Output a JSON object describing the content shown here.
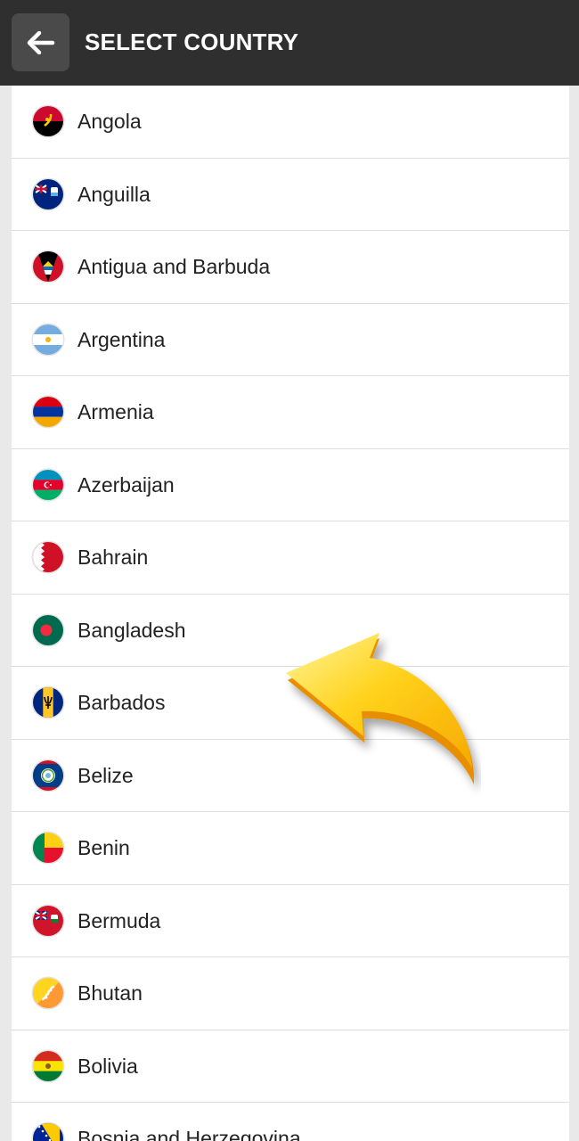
{
  "header": {
    "title": "SELECT COUNTRY",
    "back_icon": "arrow-left-icon"
  },
  "countries": [
    {
      "name": "Angola",
      "flag": "angola-flag-icon"
    },
    {
      "name": "Anguilla",
      "flag": "anguilla-flag-icon"
    },
    {
      "name": "Antigua and Barbuda",
      "flag": "antigua-and-barbuda-flag-icon"
    },
    {
      "name": "Argentina",
      "flag": "argentina-flag-icon"
    },
    {
      "name": "Armenia",
      "flag": "armenia-flag-icon"
    },
    {
      "name": "Azerbaijan",
      "flag": "azerbaijan-flag-icon"
    },
    {
      "name": "Bahrain",
      "flag": "bahrain-flag-icon"
    },
    {
      "name": "Bangladesh",
      "flag": "bangladesh-flag-icon"
    },
    {
      "name": "Barbados",
      "flag": "barbados-flag-icon"
    },
    {
      "name": "Belize",
      "flag": "belize-flag-icon"
    },
    {
      "name": "Benin",
      "flag": "benin-flag-icon"
    },
    {
      "name": "Bermuda",
      "flag": "bermuda-flag-icon"
    },
    {
      "name": "Bhutan",
      "flag": "bhutan-flag-icon"
    },
    {
      "name": "Bolivia",
      "flag": "bolivia-flag-icon"
    },
    {
      "name": "Bosnia and Herzegovina",
      "flag": "bosnia-and-herzegovina-flag-icon"
    }
  ],
  "overlay": {
    "icon": "pointer-arrow-icon",
    "color": "#f7b500"
  }
}
